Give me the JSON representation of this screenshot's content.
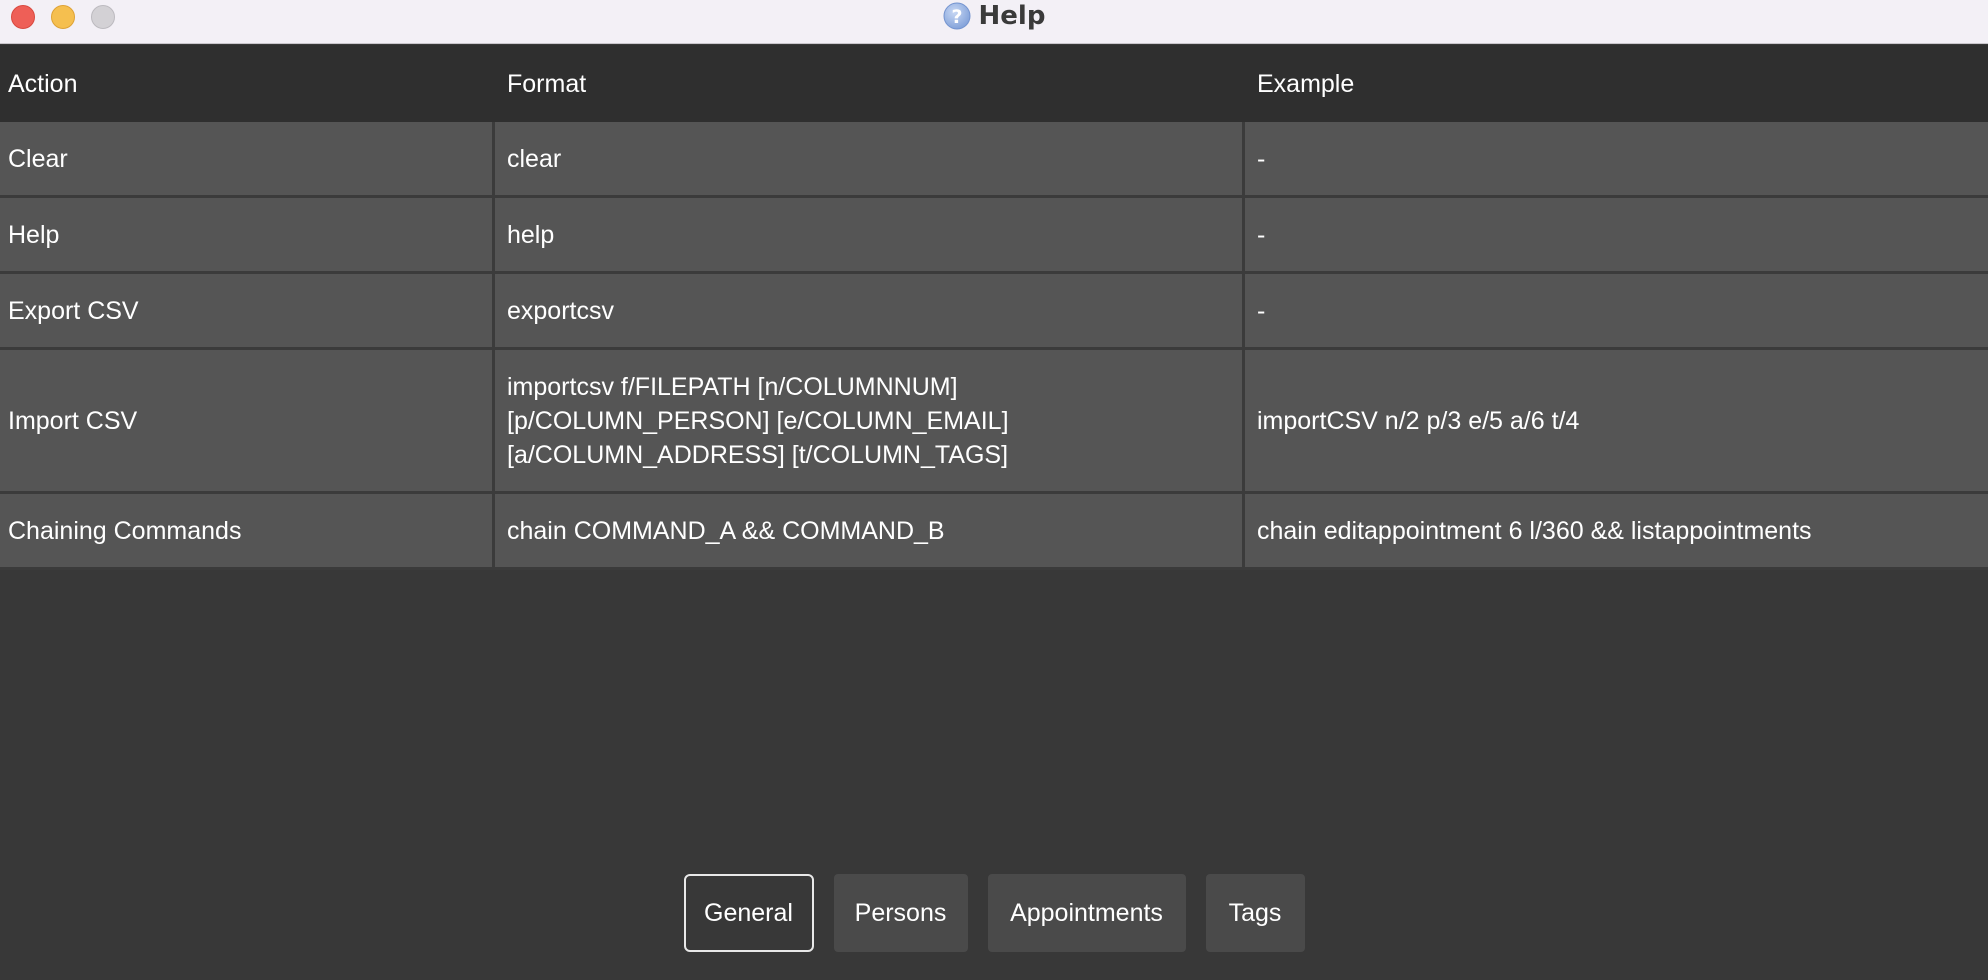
{
  "window": {
    "title": "Help"
  },
  "table": {
    "headers": {
      "action": "Action",
      "format": "Format",
      "example": "Example"
    },
    "rows": [
      {
        "action": "Clear",
        "format": [
          "clear"
        ],
        "example": "-"
      },
      {
        "action": "Help",
        "format": [
          "help"
        ],
        "example": "-"
      },
      {
        "action": "Export CSV",
        "format": [
          "exportcsv"
        ],
        "example": "-"
      },
      {
        "action": "Import CSV",
        "format": [
          "importcsv f/FILEPATH [n/COLUMNNUM]",
          "[p/COLUMN_PERSON] [e/COLUMN_EMAIL]",
          "[a/COLUMN_ADDRESS] [t/COLUMN_TAGS]"
        ],
        "example": "importCSV n/2 p/3 e/5 a/6 t/4"
      },
      {
        "action": "Chaining Commands",
        "format": [
          "chain COMMAND_A && COMMAND_B"
        ],
        "example": "chain editappointment 6 l/360 && listappointments"
      }
    ]
  },
  "tabs": {
    "general": "General",
    "persons": "Persons",
    "appointments": "Appointments",
    "tags": "Tags",
    "selected": "General"
  },
  "colors": {
    "background": "#383838",
    "header": "#2f2f2f",
    "row": "#555555",
    "close": "#ee5f57",
    "minimize": "#f5bf4f",
    "zoom": "#d3d1d5",
    "help_icon": "#8aa8dd"
  },
  "icons": {
    "title_icon": "help-question-icon"
  }
}
